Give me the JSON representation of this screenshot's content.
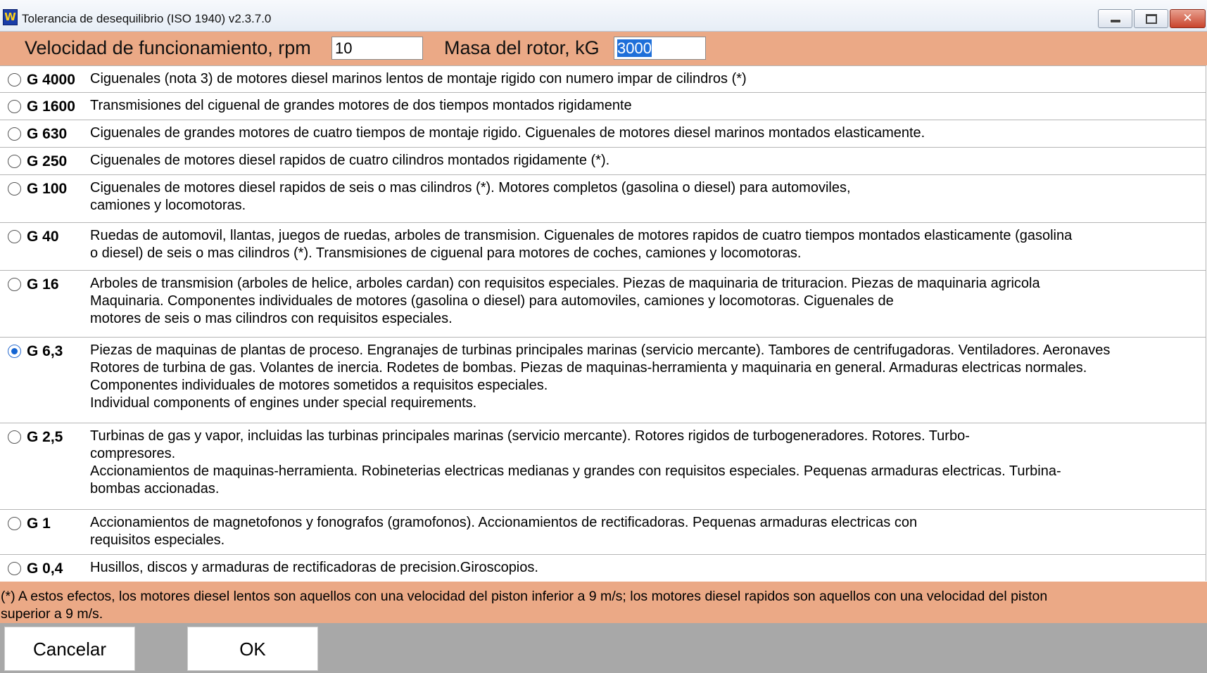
{
  "window": {
    "title": "Tolerancia de desequilibrio (ISO 1940) v2.3.7.0",
    "app_icon_text": "W",
    "minimize": "minimize-icon",
    "maximize": "maximize-icon",
    "close": "✕"
  },
  "params": {
    "speed_label": "Velocidad de funcionamiento, rpm",
    "speed_value": "10",
    "mass_label": "Masa del rotor, kG",
    "mass_value": "3000"
  },
  "grades": [
    {
      "grade": "G 4000",
      "selected": false,
      "lines": [
        "Ciguenales (nota 3) de motores diesel marinos lentos de montaje rigido con numero impar de cilindros (*)"
      ]
    },
    {
      "grade": "G 1600",
      "selected": false,
      "lines": [
        "Transmisiones del ciguenal de grandes motores de dos tiempos montados rigidamente"
      ]
    },
    {
      "grade": "G 630",
      "selected": false,
      "lines": [
        "Ciguenales de grandes motores de cuatro tiempos de montaje rigido. Ciguenales de motores diesel marinos montados elasticamente."
      ]
    },
    {
      "grade": "G 250",
      "selected": false,
      "lines": [
        "Ciguenales de motores diesel rapidos de cuatro cilindros montados rigidamente (*)."
      ]
    },
    {
      "grade": "G 100",
      "selected": false,
      "lines": [
        "Ciguenales de motores diesel rapidos de seis o mas cilindros (*). Motores completos (gasolina o diesel) para automoviles,",
        "camiones y locomotoras."
      ]
    },
    {
      "grade": "G 40",
      "selected": false,
      "lines": [
        "Ruedas de automovil, llantas, juegos de ruedas, arboles de transmision. Ciguenales de motores rapidos de cuatro tiempos montados elasticamente (gasolina",
        "o diesel) de seis o mas cilindros (*). Transmisiones de ciguenal para motores de coches, camiones y locomotoras."
      ]
    },
    {
      "grade": "G 16",
      "selected": false,
      "lines": [
        "Arboles de transmision (arboles de helice, arboles cardan) con requisitos especiales. Piezas de maquinaria de trituracion. Piezas de maquinaria agricola",
        "Maquinaria. Componentes individuales de motores (gasolina o diesel) para automoviles, camiones y locomotoras. Ciguenales de",
        "motores de seis o mas cilindros con requisitos especiales."
      ]
    },
    {
      "grade": "G 6,3",
      "selected": true,
      "lines": [
        " Piezas de maquinas de plantas de proceso. Engranajes de turbinas principales marinas (servicio mercante). Tambores de centrifugadoras. Ventiladores. Aeronaves",
        "Rotores de turbina de gas. Volantes de inercia. Rodetes de bombas. Piezas de maquinas-herramienta y maquinaria en general. Armaduras electricas normales.",
        "Componentes individuales de motores sometidos a requisitos especiales.",
        "Individual components of engines under special requirements."
      ]
    },
    {
      "grade": "G 2,5",
      "selected": false,
      "lines": [
        "Turbinas de gas y vapor, incluidas las turbinas principales marinas (servicio mercante). Rotores rigidos de turbogeneradores. Rotores. Turbo-",
        "compresores.",
        "Accionamientos de maquinas-herramienta. Robineterias electricas medianas y grandes con requisitos especiales. Pequenas armaduras electricas. Turbina-",
        "bombas accionadas."
      ]
    },
    {
      "grade": "G 1",
      "selected": false,
      "lines": [
        "Accionamientos de magnetofonos y fonografos (gramofonos). Accionamientos de rectificadoras. Pequenas armaduras electricas con",
        "requisitos especiales."
      ]
    },
    {
      "grade": "G 0,4",
      "selected": false,
      "lines": [
        "Husillos, discos y armaduras de rectificadoras de precision.Giroscopios."
      ]
    }
  ],
  "footnote": {
    "line1": "(*) A estos efectos, los motores diesel lentos son aquellos con una velocidad del piston inferior a 9 m/s; los motores diesel rapidos son aquellos con una velocidad del piston",
    "line2": "superior a 9 m/s."
  },
  "buttons": {
    "cancel": "Cancelar",
    "ok": "OK"
  }
}
